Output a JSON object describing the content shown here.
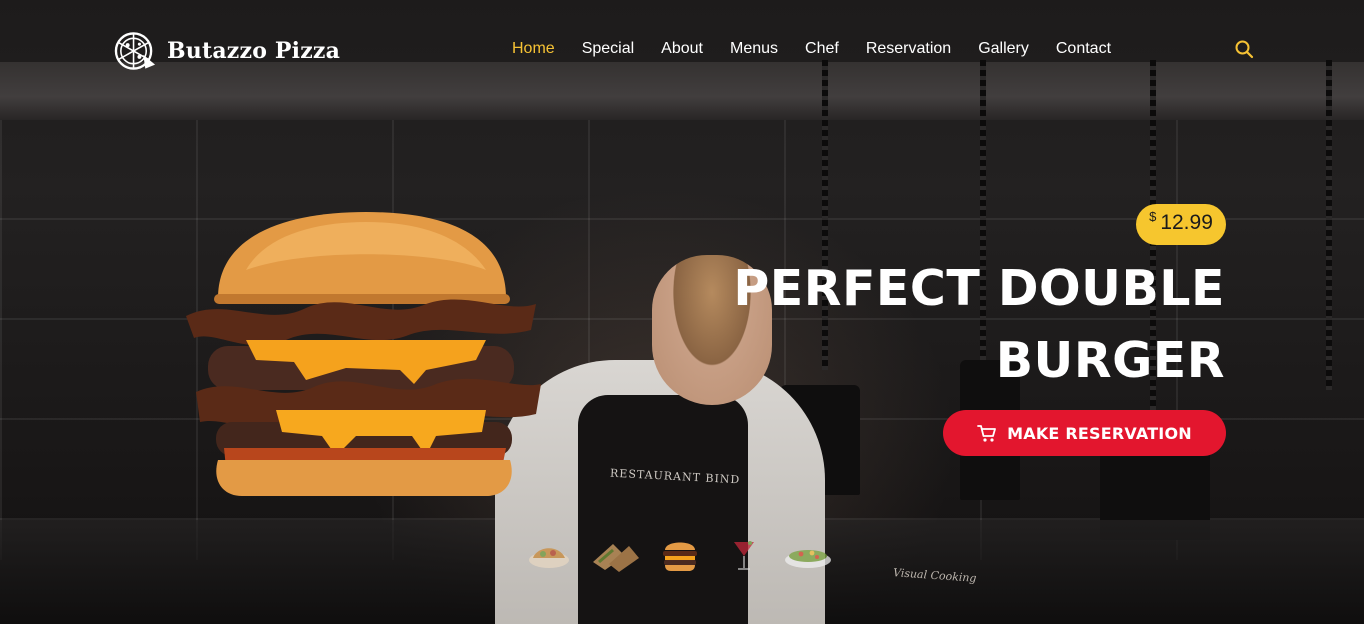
{
  "brand": {
    "name": "Butazzo Pizza",
    "logo_icon": "pizza-icon"
  },
  "nav": {
    "items": [
      {
        "label": "Home",
        "active": true
      },
      {
        "label": "Special",
        "active": false
      },
      {
        "label": "About",
        "active": false
      },
      {
        "label": "Menus",
        "active": false
      },
      {
        "label": "Chef",
        "active": false
      },
      {
        "label": "Reservation",
        "active": false
      },
      {
        "label": "Gallery",
        "active": false
      },
      {
        "label": "Contact",
        "active": false
      }
    ],
    "search_icon": "search-icon",
    "active_color": "#f6c234"
  },
  "hero": {
    "price_currency": "$",
    "price_amount": "12.99",
    "headline_line1": "PERFECT DOUBLE",
    "headline_line2": "BURGER",
    "cta_label": "MAKE RESERVATION",
    "cta_icon": "cart-icon",
    "cta_color": "#e3162e",
    "price_color": "#f6c62e",
    "apron_text": "RESTAURANT BIND",
    "signature": "Visual Cooking"
  },
  "slider": {
    "thumbs": [
      {
        "name": "taco-plate-thumb",
        "active": false
      },
      {
        "name": "wrap-thumb",
        "active": false
      },
      {
        "name": "burger-thumb",
        "active": true
      },
      {
        "name": "cocktail-thumb",
        "active": false
      },
      {
        "name": "salad-bowl-thumb",
        "active": false
      }
    ]
  }
}
